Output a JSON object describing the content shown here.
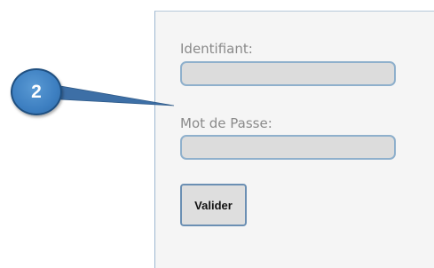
{
  "login_form": {
    "username_label": "Identifiant:",
    "username_value": "",
    "password_label": "Mot de Passe:",
    "password_value": "",
    "submit_label": "Valider"
  },
  "callout": {
    "number": "2",
    "badge_color": "#3d7fc1",
    "line_color": "#3d6fa6"
  },
  "colors": {
    "panel_background": "#f5f5f5",
    "input_background": "#dcdcdc",
    "input_border": "#8fb0cc",
    "button_border": "#6b8fb3"
  }
}
